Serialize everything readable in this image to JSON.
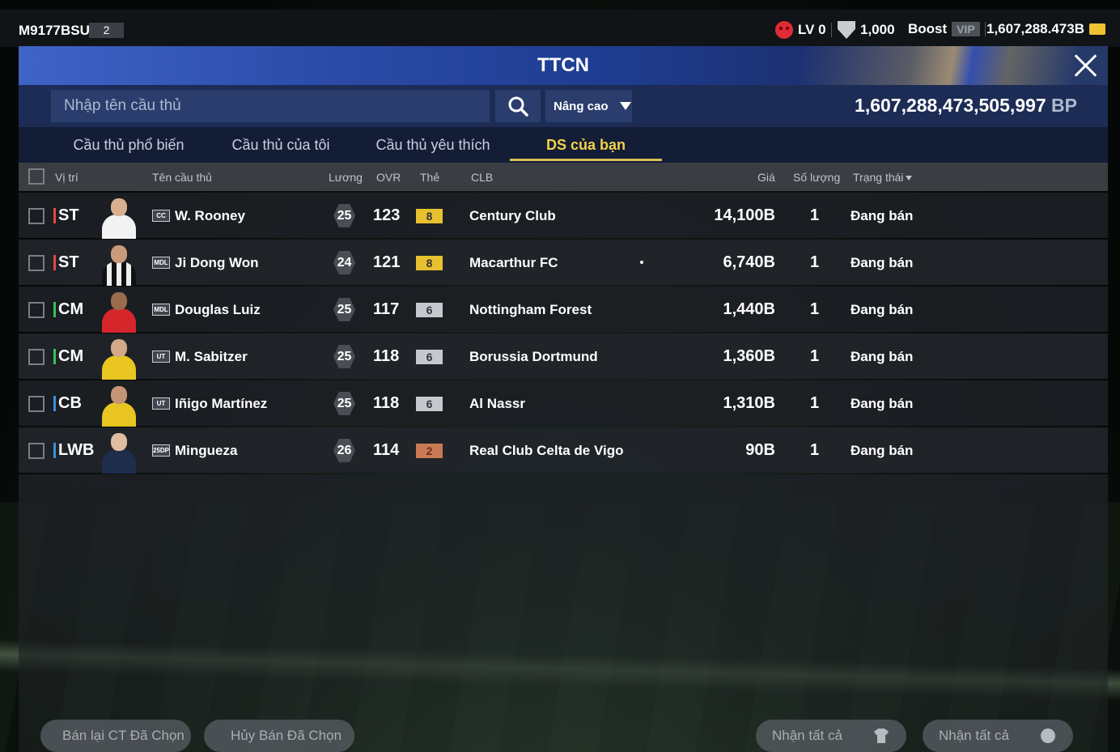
{
  "topbar": {
    "account_id": "M9177BSU",
    "account_num": "2",
    "level": "LV 0",
    "trophies": "1,000",
    "boost": "Boost",
    "vip": "VIP",
    "coins": "1,607,288.473B"
  },
  "header": {
    "title": "TTCN"
  },
  "search": {
    "placeholder": "Nhập tên cầu thủ",
    "advanced_label": "Nâng cao",
    "bp_value": "1,607,288,473,505,997",
    "bp_unit": "BP"
  },
  "tabs": [
    {
      "label": "Cầu thủ phổ biến"
    },
    {
      "label": "Cầu thủ của tôi"
    },
    {
      "label": "Cầu thủ yêu thích"
    },
    {
      "label": "DS của bạn"
    }
  ],
  "table": {
    "headers": {
      "position": "Vị trí",
      "name": "Tên cầu thủ",
      "wage": "Lương",
      "ovr": "OVR",
      "grade": "Thẻ",
      "club": "CLB",
      "price": "Giá",
      "qty": "Số lượng",
      "status": "Trạng thái"
    },
    "rows": [
      {
        "position": "ST",
        "season": "CC",
        "name": "W. Rooney",
        "wage": "25",
        "ovr": "123",
        "grade": "8",
        "club": "Century Club",
        "price": "14,100B",
        "qty": "1",
        "status": "Đang bán"
      },
      {
        "position": "ST",
        "season": "MDL",
        "name": "Ji Dong Won",
        "wage": "24",
        "ovr": "121",
        "grade": "8",
        "club": "Macarthur FC",
        "price": "6,740B",
        "qty": "1",
        "status": "Đang bán"
      },
      {
        "position": "CM",
        "season": "MDL",
        "name": "Douglas Luiz",
        "wage": "25",
        "ovr": "117",
        "grade": "6",
        "club": "Nottingham Forest",
        "price": "1,440B",
        "qty": "1",
        "status": "Đang bán"
      },
      {
        "position": "CM",
        "season": "UT",
        "name": "M. Sabitzer",
        "wage": "25",
        "ovr": "118",
        "grade": "6",
        "club": "Borussia Dortmund",
        "price": "1,360B",
        "qty": "1",
        "status": "Đang bán"
      },
      {
        "position": "CB",
        "season": "UT",
        "name": "Iñigo Martínez",
        "wage": "25",
        "ovr": "118",
        "grade": "6",
        "club": "Al Nassr",
        "price": "1,310B",
        "qty": "1",
        "status": "Đang bán"
      },
      {
        "position": "LWB",
        "season": "25DP",
        "name": "Mingueza",
        "wage": "26",
        "ovr": "114",
        "grade": "2",
        "club": "Real Club Celta de Vigo",
        "price": "90B",
        "qty": "1",
        "status": "Đang bán"
      }
    ]
  },
  "footer": {
    "resell_selected": "Bán lại CT Đã Chọn",
    "cancel_selected": "Hủy Bán Đã Chọn",
    "receive_all_players": "Nhận tất cả",
    "receive_all_bp": "Nhận tất cả"
  },
  "colors": {
    "tab_active": "#f2d24a",
    "grade_gold": "#e6c02f",
    "grade_silver": "#c4c9cf",
    "grade_bronze": "#c97a55",
    "pos_forward": "#e04848",
    "pos_mid": "#37c15c",
    "pos_def": "#3a8fe0"
  }
}
